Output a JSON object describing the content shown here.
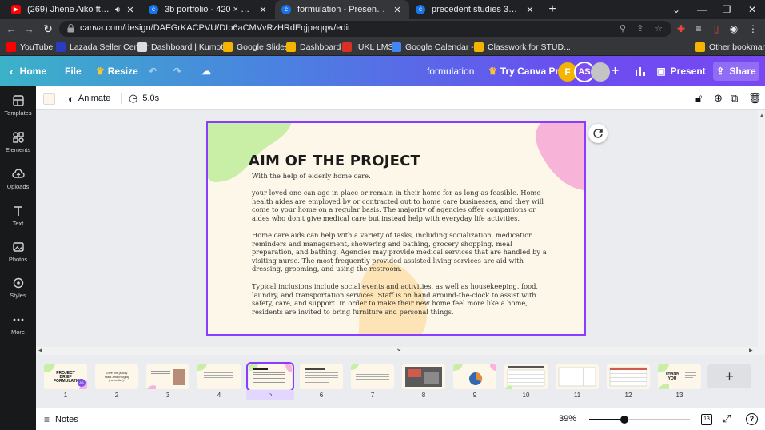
{
  "browser": {
    "tabs": [
      {
        "title": "(269) Jhene Aiko ft. The Wee",
        "icon": "youtube-icon",
        "active": false
      },
      {
        "title": "3b portfolio - 420 × 297mm",
        "icon": "canva-icon",
        "active": false
      },
      {
        "title": "formulation - Presentation",
        "icon": "canva-icon",
        "active": true
      },
      {
        "title": "precedent studies 3B - Presentati",
        "icon": "canva-icon",
        "active": false
      }
    ],
    "url": "canva.com/design/DAFGrKACPVU/DIp6aCMVvRzHRdEqjpeqqw/edit",
    "bookmarks": [
      {
        "label": "YouTube",
        "color": "#ff0000"
      },
      {
        "label": "Lazada Seller Center",
        "color": "#2b3cc4"
      },
      {
        "label": "Dashboard | Kumot...",
        "color": "#ffffff"
      },
      {
        "label": "Google Slides",
        "color": "#f4b400"
      },
      {
        "label": "Dashboard",
        "color": "#f4b400"
      },
      {
        "label": "IUKL LMS",
        "color": "#d93025"
      },
      {
        "label": "Google Calendar -...",
        "color": "#4285f4"
      },
      {
        "label": "Classwork for STUD...",
        "color": "#f4b400"
      }
    ],
    "other_bookmarks": "Other bookmarks"
  },
  "canva_header": {
    "home": "Home",
    "file": "File",
    "resize": "Resize",
    "doc_title": "formulation",
    "try_pro": "Try Canva Pro",
    "avatar1": "F",
    "avatar2": "AS",
    "present": "Present",
    "share": "Share"
  },
  "sidebar": [
    {
      "label": "Templates",
      "icon": "templates-icon"
    },
    {
      "label": "Elements",
      "icon": "elements-icon"
    },
    {
      "label": "Uploads",
      "icon": "uploads-icon"
    },
    {
      "label": "Text",
      "icon": "text-icon"
    },
    {
      "label": "Photos",
      "icon": "photos-icon"
    },
    {
      "label": "Styles",
      "icon": "styles-icon"
    },
    {
      "label": "More",
      "icon": "more-icon"
    }
  ],
  "editor_toolbar": {
    "animate": "Animate",
    "duration": "5.0s"
  },
  "slide": {
    "title": "AIM OF THE PROJECT",
    "subtitle": "With the help of elderly home care.",
    "paragraphs": [
      "your loved one can age in place or remain in their home for as long as feasible. Home health aides are employed by or contracted out to home care businesses, and they will come to your home on a regular basis. The majority of agencies offer companions or aides who don't give medical care but instead help with everyday life activities.",
      "Home care aids can help with a variety of tasks, including socialization, medication reminders and management, showering and bathing, grocery shopping, meal preparation, and bathing. Agencies may provide medical services that are handled by a visiting nurse. The most frequently provided assisted living services are aid with dressing, grooming, and using the restroom.",
      "Typical inclusions include social events and activities, as well as housekeeping, food, laundry, and transportation services. Staff is on hand around-the-clock to assist with safety, care, and support. In order to make their new home feel more like a home, residents are invited to bring furniture and personal things."
    ]
  },
  "pages": {
    "numbers": [
      "1",
      "2",
      "3",
      "4",
      "5",
      "6",
      "7",
      "8",
      "9",
      "10",
      "11",
      "12",
      "13"
    ],
    "selected": "5",
    "thumb1_title": "PROJECT BRIEF FORMULATION",
    "thumb2_text": "Give the [study stats and insight] (hereafter).",
    "thumb13_title": "THANK YOU"
  },
  "footer": {
    "notes": "Notes",
    "zoom": "39%",
    "page_count": "13",
    "zoom_fraction": 0.39
  }
}
